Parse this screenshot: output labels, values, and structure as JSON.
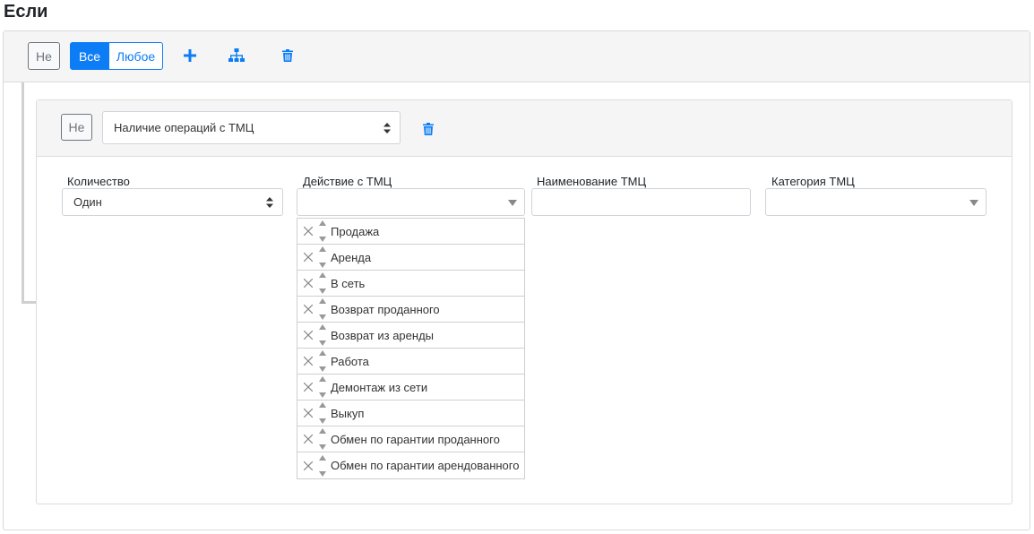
{
  "page": {
    "title": "Если"
  },
  "group": {
    "not_label": "Не",
    "all_label": "Все",
    "any_label": "Любое",
    "icons": [
      "plus-icon",
      "sitemap-icon",
      "trash-icon"
    ]
  },
  "rule": {
    "not_label": "Не",
    "condition_value": "Наличие операций с ТМЦ",
    "icons": [
      "trash-icon"
    ]
  },
  "fields": {
    "quantity": {
      "label": "Количество",
      "value": "Один"
    },
    "action": {
      "label": "Действие с ТМЦ",
      "value": ""
    },
    "name": {
      "label": "Наименование ТМЦ",
      "value": ""
    },
    "category": {
      "label": "Категория ТМЦ",
      "value": ""
    }
  },
  "action_items": [
    "Продажа",
    "Аренда",
    "В сеть",
    "Возврат проданного",
    "Возврат из аренды",
    "Работа",
    "Демонтаж из сети",
    "Выкуп",
    "Обмен по гарантии проданного",
    "Обмен по гарантии арендованного"
  ],
  "colors": {
    "accent": "#0d7df6",
    "panel_bg": "#f5f5f5",
    "border": "#dcdcdc"
  }
}
